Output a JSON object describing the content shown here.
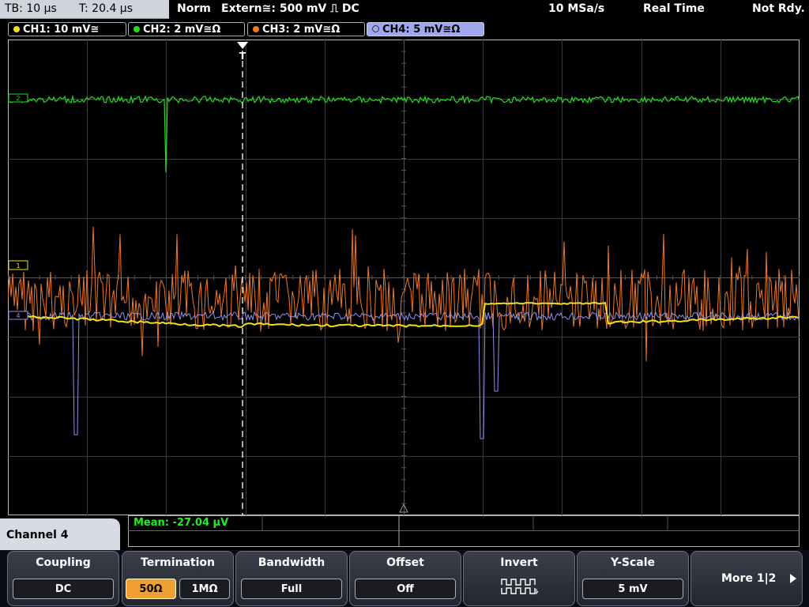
{
  "status_bar": {
    "timebase": "TB: 10 µs",
    "trigger_time": "T: 20.4 µs",
    "mode": "Norm",
    "trigger_source": "Extern≅: 500 mV ⎍ DC",
    "sample_rate": "10 MSa/s",
    "acq_mode": "Real Time",
    "state": "Not Rdy."
  },
  "channels": [
    {
      "label": "CH1: 10 mV≅",
      "color": "#f2e01e",
      "marker": "1"
    },
    {
      "label": "CH2: 2 mV≅Ω",
      "color": "#22dd22",
      "marker": "2"
    },
    {
      "label": "CH3: 2 mV≅Ω",
      "color": "#f07820",
      "marker": "3"
    },
    {
      "label": "CH4: 5 mV≅Ω",
      "color": "#8f90f0",
      "marker": "4"
    }
  ],
  "trigger_marker": "T",
  "measurement": {
    "mean": "Mean: -27.04 µV",
    "color": "#22ee22"
  },
  "menu": {
    "panel_title": "Channel 4",
    "coupling": {
      "title": "Coupling",
      "value": "DC"
    },
    "termination": {
      "title": "Termination",
      "options": [
        "50Ω",
        "1MΩ"
      ],
      "selected": 0
    },
    "bandwidth": {
      "title": "Bandwidth",
      "value": "Full"
    },
    "offset": {
      "title": "Offset",
      "value": "Off"
    },
    "invert": {
      "title": "Invert",
      "icon": "invert-waveform-icon"
    },
    "yscale": {
      "title": "Y-Scale",
      "value": "5 mV"
    },
    "more": {
      "label": "More 1|2",
      "icon": "arrow-right-icon"
    }
  }
}
